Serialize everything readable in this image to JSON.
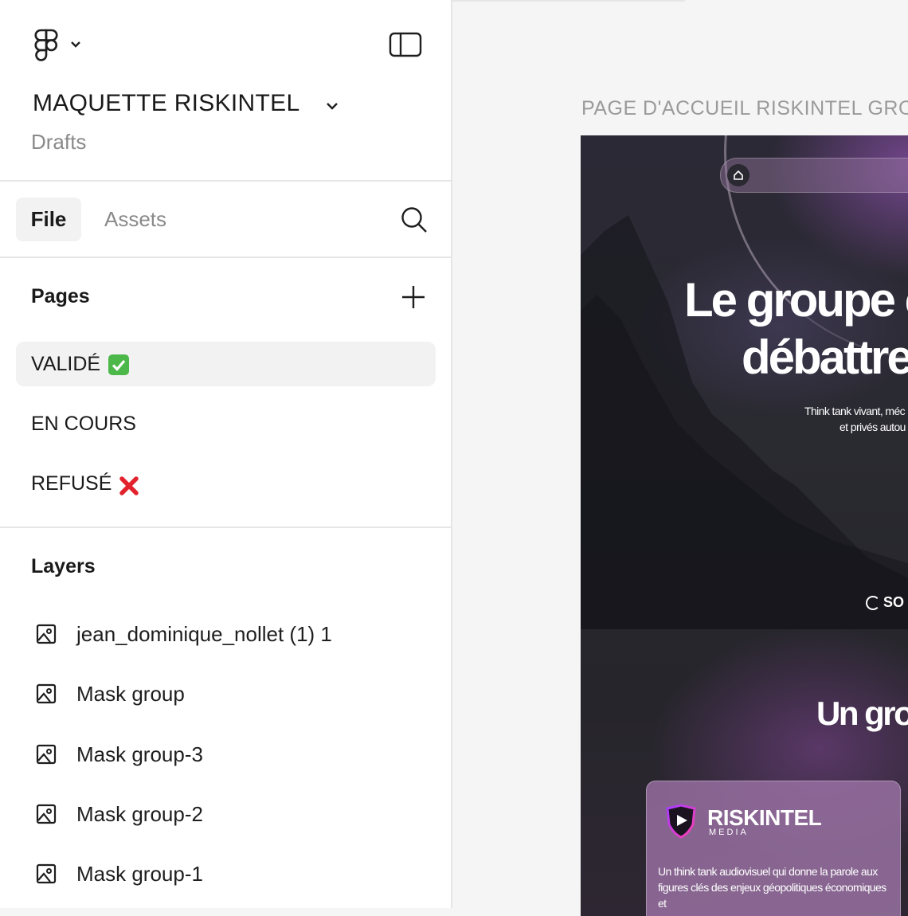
{
  "app": {
    "logo_icon": "figma-logo-icon",
    "sidebar_toggle_icon": "sidebar-toggle-icon"
  },
  "project": {
    "title": "MAQUETTE RISKINTEL",
    "location": "Drafts"
  },
  "tabs": {
    "file": "File",
    "assets": "Assets",
    "search_icon": "search-icon"
  },
  "pages": {
    "heading": "Pages",
    "add_icon": "plus-icon",
    "items": [
      {
        "label": "VALIDÉ",
        "emoji": "check-mark-button-emoji",
        "active": true
      },
      {
        "label": "EN COURS",
        "active": false
      },
      {
        "label": "REFUSÉ",
        "emoji": "cross-mark-emoji",
        "active": false
      }
    ]
  },
  "layers": {
    "heading": "Layers",
    "items": [
      {
        "label": "jean_dominique_nollet (1) 1",
        "icon": "image-icon"
      },
      {
        "label": "Mask group",
        "icon": "image-icon"
      },
      {
        "label": "Mask group-3",
        "icon": "image-icon"
      },
      {
        "label": "Mask group-2",
        "icon": "image-icon"
      },
      {
        "label": "Mask group-1",
        "icon": "image-icon"
      }
    ]
  },
  "canvas": {
    "frame_label": "PAGE D'ACCUEIL RISKINTEL GRO",
    "hero_line1": "Le groupe c",
    "hero_line2": "débattre",
    "subtitle_line1": "Think tank vivant, méc",
    "subtitle_line2": "et privés autou",
    "so_text": "SO",
    "hero_line3": "Un gro",
    "card": {
      "brand": "RISKINTEL",
      "brand_sub": "MEDIA",
      "text": "Un think tank audiovisuel qui donne la parole aux figures clés des enjeux géopolitiques économiques et"
    }
  },
  "colors": {
    "active_row_bg": "#f2f2f2",
    "muted_text": "#8a8a8a",
    "canvas_bg": "#f5f5f5",
    "frame_bg": "#2a2a31"
  }
}
